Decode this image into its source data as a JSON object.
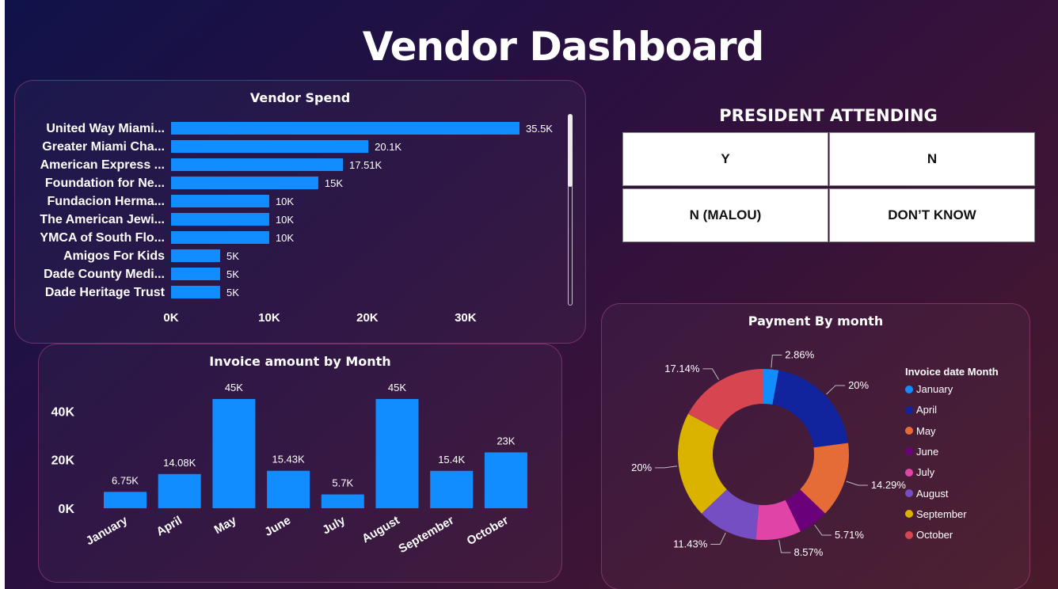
{
  "title": "Vendor Dashboard",
  "colors": {
    "bar": "#118dff",
    "text": "#ffffff"
  },
  "president": {
    "title": "PRESIDENT ATTENDING",
    "buttons": [
      "Y",
      "N",
      "N (MALOU)",
      "DON’T KNOW"
    ]
  },
  "legend": {
    "title": "Invoice date Month",
    "items": [
      {
        "label": "January",
        "color": "#118dff"
      },
      {
        "label": "April",
        "color": "#12239e"
      },
      {
        "label": "May",
        "color": "#e66c37"
      },
      {
        "label": "June",
        "color": "#6b007b"
      },
      {
        "label": "July",
        "color": "#e044a7"
      },
      {
        "label": "August",
        "color": "#744ec2"
      },
      {
        "label": "September",
        "color": "#d9b300"
      },
      {
        "label": "October",
        "color": "#d64550"
      }
    ]
  },
  "chart_data": [
    {
      "type": "bar",
      "orientation": "horizontal",
      "title": "Vendor Spend",
      "categories": [
        "United Way Miami...",
        "Greater Miami Cha...",
        "American Express ...",
        "Foundation for Ne...",
        "Fundacion Herma...",
        "The American Jewi...",
        "YMCA of South Flo...",
        "Amigos For Kids",
        "Dade County Medi...",
        "Dade Heritage Trust"
      ],
      "values": [
        35500,
        20100,
        17510,
        15000,
        10000,
        10000,
        10000,
        5000,
        5000,
        5000
      ],
      "value_labels": [
        "35.5K",
        "20.1K",
        "17.51K",
        "15K",
        "10K",
        "10K",
        "10K",
        "5K",
        "5K",
        "5K"
      ],
      "x_ticks": [
        "0K",
        "10K",
        "20K",
        "30K"
      ],
      "xlim": [
        0,
        36500
      ]
    },
    {
      "type": "bar",
      "title": "Invoice amount by Month",
      "categories": [
        "January",
        "April",
        "May",
        "June",
        "July",
        "August",
        "September",
        "October"
      ],
      "values": [
        6750,
        14080,
        45000,
        15430,
        5700,
        45000,
        15400,
        23000
      ],
      "value_labels": [
        "6.75K",
        "14.08K",
        "45K",
        "15.43K",
        "5.7K",
        "45K",
        "15.4K",
        "23K"
      ],
      "y_ticks": [
        "0K",
        "20K",
        "40K"
      ],
      "ylim": [
        0,
        45000
      ]
    },
    {
      "type": "pie",
      "donut": true,
      "title": "Payment By month",
      "categories": [
        "January",
        "April",
        "May",
        "June",
        "July",
        "August",
        "September",
        "October"
      ],
      "values": [
        2.86,
        20,
        14.29,
        5.71,
        8.57,
        11.43,
        20,
        17.14
      ],
      "value_labels": [
        "2.86%",
        "20%",
        "14.29%",
        "5.71%",
        "8.57%",
        "11.43%",
        "20%",
        "17.14%"
      ]
    }
  ]
}
